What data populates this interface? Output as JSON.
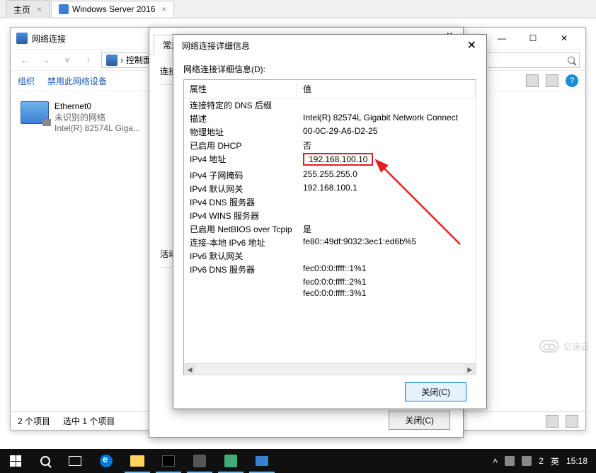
{
  "tabs": {
    "home": "主页",
    "active": "Windows Server 2016"
  },
  "nc_window": {
    "title": "网络连接",
    "breadcrumb": "控制面板",
    "toolbar": {
      "organize": "组织",
      "disable": "禁用此网络设备"
    },
    "adapter": {
      "name": "Ethernet0",
      "status": "未识别的网络",
      "device": "Intel(R) 82574L Giga..."
    },
    "status": {
      "items": "2 个项目",
      "selected": "选中 1 个项目"
    }
  },
  "props": {
    "tab_general": "常规",
    "connect_label": "连接",
    "activity_label": "活动",
    "close": "关闭(C)"
  },
  "dialog": {
    "title": "网络连接详细信息",
    "list_label": "网络连接详细信息(D):",
    "header_prop": "属性",
    "header_val": "值",
    "rows": [
      {
        "prop": "连接特定的 DNS 后缀",
        "val": ""
      },
      {
        "prop": "描述",
        "val": "Intel(R) 82574L Gigabit Network Connect"
      },
      {
        "prop": "物理地址",
        "val": "00-0C-29-A6-D2-25"
      },
      {
        "prop": "已启用 DHCP",
        "val": "否"
      },
      {
        "prop": "IPv4 地址",
        "val": "192.168.100.10",
        "highlight": true
      },
      {
        "prop": "IPv4 子网掩码",
        "val": "255.255.255.0"
      },
      {
        "prop": "IPv4 默认网关",
        "val": "192.168.100.1"
      },
      {
        "prop": "IPv4 DNS 服务器",
        "val": ""
      },
      {
        "prop": "IPv4 WINS 服务器",
        "val": ""
      },
      {
        "prop": "已启用 NetBIOS over Tcpip",
        "val": "是"
      },
      {
        "prop": "连接-本地 IPv6 地址",
        "val": "fe80::49df:9032:3ec1:ed6b%5"
      },
      {
        "prop": "IPv6 默认网关",
        "val": ""
      },
      {
        "prop": "IPv6 DNS 服务器",
        "val": "fec0:0:0:ffff::1%1"
      },
      {
        "prop": "",
        "val": "fec0:0:0:ffff::2%1"
      },
      {
        "prop": "",
        "val": "fec0:0:0:ffff::3%1"
      }
    ],
    "close": "关闭(C)"
  },
  "taskbar": {
    "ime_lang": "英",
    "ime_num": "2",
    "time": "15:18"
  },
  "watermark": "亿速云"
}
